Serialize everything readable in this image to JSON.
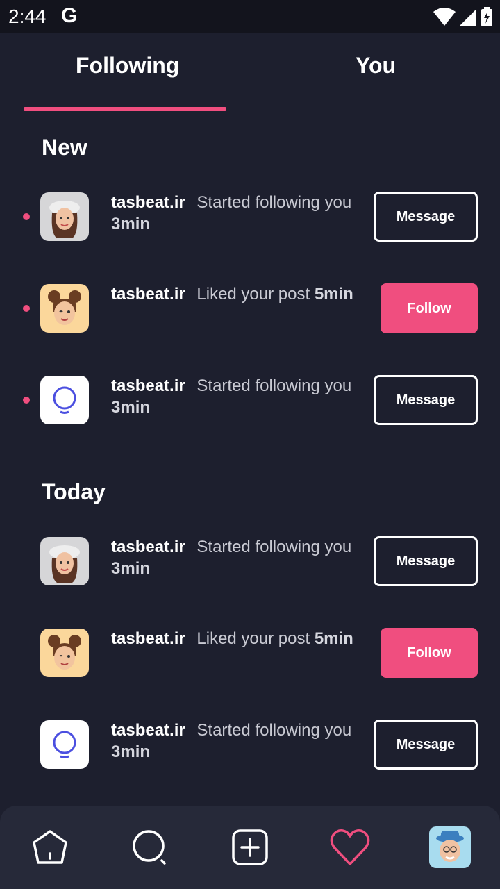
{
  "status": {
    "time": "2:44",
    "google": "G"
  },
  "tabs": [
    {
      "label": "Following"
    },
    {
      "label": "You"
    }
  ],
  "sections": [
    {
      "title": "New",
      "items": [
        {
          "user": "tasbeat.ir",
          "action": "Started following you",
          "time": "3min",
          "button": "Message",
          "avatar": "girl-hat-memoji",
          "unread": true
        },
        {
          "user": "tasbeat.ir",
          "action": "Liked your post",
          "time": "5min",
          "button": "Follow",
          "avatar": "girl-buns-memoji",
          "unread": true
        },
        {
          "user": "tasbeat.ir",
          "action": "Started following you",
          "time": "3min",
          "button": "Message",
          "avatar": "ring-logo",
          "unread": true
        }
      ]
    },
    {
      "title": "Today",
      "items": [
        {
          "user": "tasbeat.ir",
          "action": "Started following you",
          "time": "3min",
          "button": "Message",
          "avatar": "girl-hat-memoji",
          "unread": false
        },
        {
          "user": "tasbeat.ir",
          "action": "Liked your post",
          "time": "5min",
          "button": "Follow",
          "avatar": "girl-buns-memoji",
          "unread": false
        },
        {
          "user": "tasbeat.ir",
          "action": "Started following you",
          "time": "3min",
          "button": "Message",
          "avatar": "ring-logo",
          "unread": false
        }
      ]
    }
  ],
  "nav": [
    {
      "icon": "home-icon"
    },
    {
      "icon": "search-icon"
    },
    {
      "icon": "add-icon"
    },
    {
      "icon": "heart-icon"
    },
    {
      "icon": "profile-avatar"
    }
  ],
  "colors": {
    "accent": "#f04e7f",
    "background": "#1d1f2e",
    "navbar": "#262939"
  }
}
